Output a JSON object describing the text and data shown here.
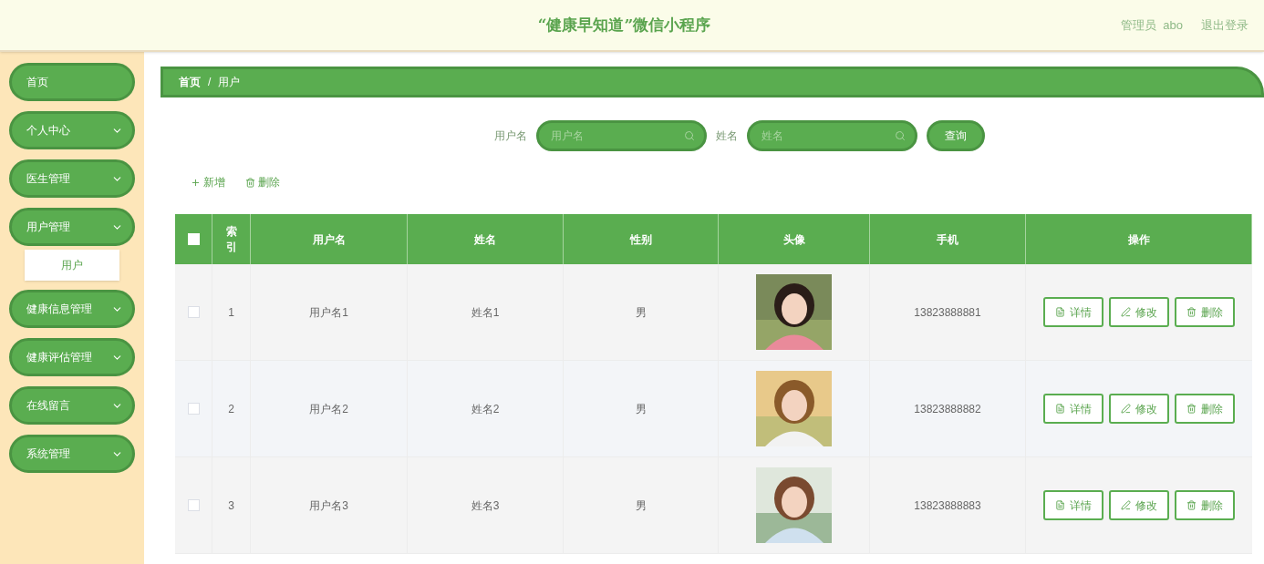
{
  "header": {
    "title": "“健康早知道”微信小程序",
    "user_role": "管理员",
    "user_name": "abo",
    "logout": "退出登录"
  },
  "sidebar": {
    "items": [
      {
        "label": "首页",
        "kind": "link"
      },
      {
        "label": "个人中心",
        "kind": "menu"
      },
      {
        "label": "医生管理",
        "kind": "menu"
      },
      {
        "label": "用户管理",
        "kind": "menu",
        "children": [
          {
            "label": "用户"
          }
        ]
      },
      {
        "label": "健康信息管理",
        "kind": "menu"
      },
      {
        "label": "健康评估管理",
        "kind": "menu"
      },
      {
        "label": "在线留言",
        "kind": "menu"
      },
      {
        "label": "系统管理",
        "kind": "menu"
      }
    ]
  },
  "breadcrumb": [
    "首页",
    "/",
    "用户"
  ],
  "search": {
    "fields": [
      {
        "label": "用户名",
        "placeholder": "用户名"
      },
      {
        "label": "姓名",
        "placeholder": "姓名"
      }
    ],
    "button": "查询"
  },
  "actions": [
    {
      "label": "新增",
      "kind": "add"
    },
    {
      "label": "删除",
      "kind": "delete"
    }
  ],
  "table": {
    "columns": [
      "索引",
      "用户名",
      "姓名",
      "性别",
      "头像",
      "手机",
      "操作"
    ],
    "header_checked": false,
    "rows": [
      {
        "checked": false,
        "index": "1",
        "username": "用户名1",
        "name": "姓名1",
        "gender": "男",
        "phone": "13823888881",
        "buttons": [
          "详情",
          "修改",
          "删除"
        ]
      },
      {
        "checked": false,
        "index": "2",
        "username": "用户名2",
        "name": "姓名2",
        "gender": "男",
        "phone": "13823888882",
        "buttons": [
          "详情",
          "修改",
          "删除"
        ]
      },
      {
        "checked": false,
        "index": "3",
        "username": "用户名3",
        "name": "姓名3",
        "gender": "男",
        "phone": "13823888883",
        "buttons": [
          "详情",
          "修改",
          "删除"
        ]
      }
    ]
  }
}
